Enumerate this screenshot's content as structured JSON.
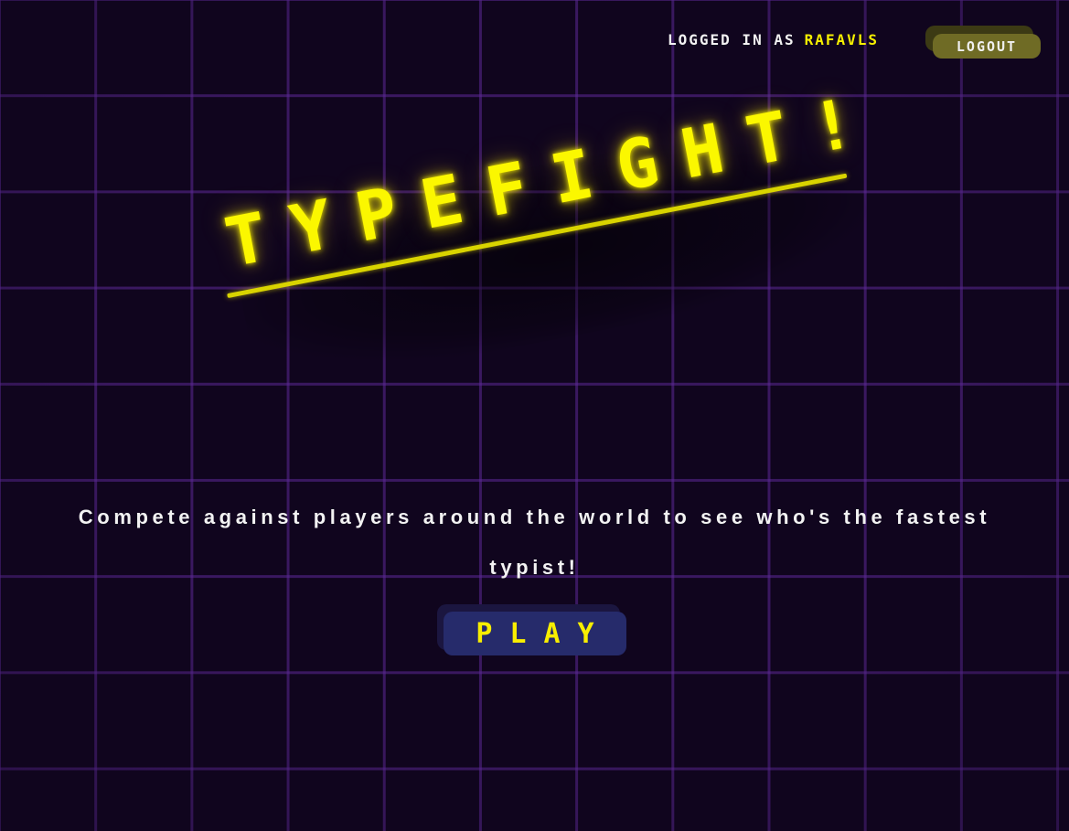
{
  "header": {
    "logged_in_label": "LOGGED IN AS",
    "username": "RAFAVLS",
    "logout_label": "LOGOUT"
  },
  "hero": {
    "title": "TYPEFIGHT!",
    "tagline": "Compete against players around the world to see who's the fastest typist!",
    "play_label": "PLAY"
  },
  "colors": {
    "background": "#10051e",
    "grid": "#5c2896",
    "accent_yellow": "#fbf700",
    "logout_button": "#6f6b25",
    "play_button": "#262b6b"
  }
}
